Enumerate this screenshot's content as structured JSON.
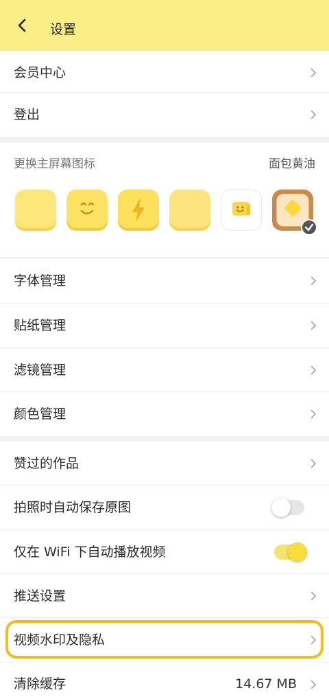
{
  "header": {
    "title": "设置"
  },
  "section1": [
    {
      "label": "会员中心"
    },
    {
      "label": "登出"
    }
  ],
  "icon_section": {
    "title": "更换主屏幕图标",
    "current": "面包黄油",
    "icons": [
      {
        "name": "yellow-square-icon"
      },
      {
        "name": "smiley-icon"
      },
      {
        "name": "lightning-icon"
      },
      {
        "name": "pale-square-icon"
      },
      {
        "name": "small-smiley-tile-icon"
      },
      {
        "name": "bread-butter-icon",
        "selected": true
      }
    ]
  },
  "section2": [
    {
      "label": "字体管理"
    },
    {
      "label": "贴纸管理"
    },
    {
      "label": "滤镜管理"
    },
    {
      "label": "颜色管理"
    }
  ],
  "section3": {
    "liked": "赞过的作品",
    "auto_save": {
      "label": "拍照时自动保存原图",
      "on": false
    },
    "wifi_autoplay": {
      "label": "仅在 WiFi 下自动播放视频",
      "on": true
    },
    "push": "推送设置",
    "watermark": "视频水印及隐私",
    "cache": {
      "label": "清除缓存",
      "value": "14.67 MB"
    }
  },
  "colors": {
    "accent": "#fcee86",
    "highlight": "#f5bb1b",
    "toggle_on": "#f7de3c"
  }
}
